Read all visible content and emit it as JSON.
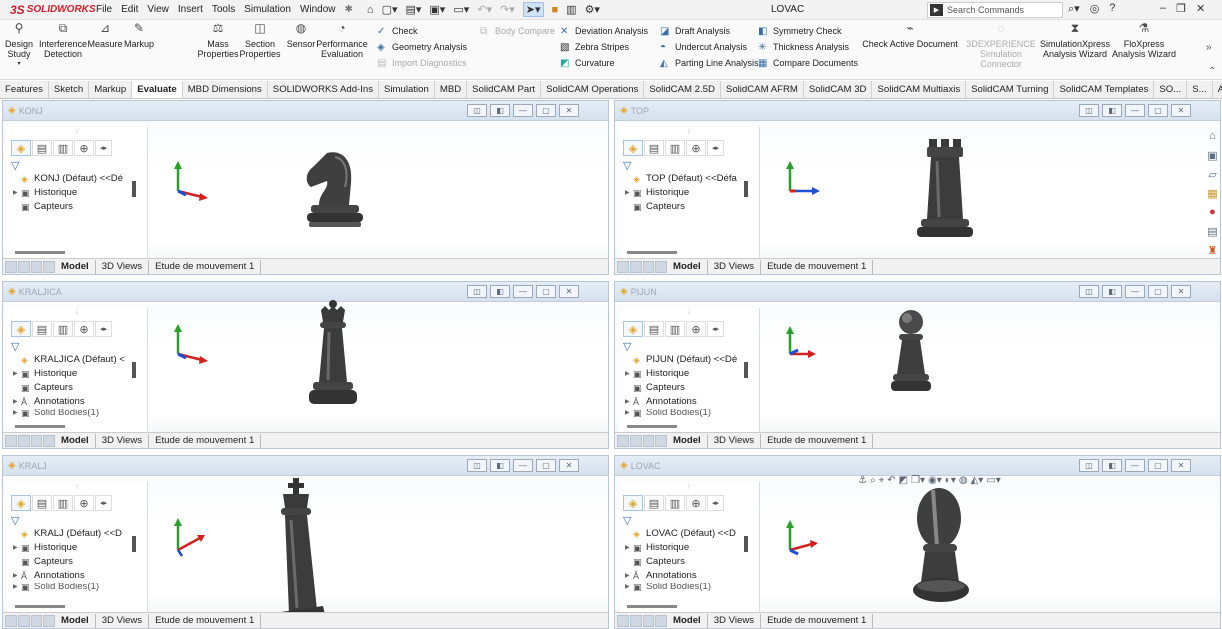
{
  "app": {
    "logo_ds": "3S",
    "logo_text": "SOLIDWORKS",
    "doc_title": "LOVAC"
  },
  "menu": [
    "File",
    "Edit",
    "View",
    "Insert",
    "Tools",
    "Simulation",
    "Window"
  ],
  "search": {
    "placeholder": "Search Commands",
    "icon": "solidworks-search-icon"
  },
  "ribbon": {
    "design_study": "Design Study",
    "interference": "Interference Detection",
    "measure": "Measure",
    "markup": "Markup",
    "mass_properties": "Mass Properties",
    "section_properties": "Section Properties",
    "sensor": "Sensor",
    "performance": "Performance Evaluation",
    "check": "Check",
    "geometry_analysis": "Geometry Analysis",
    "import_diagnostics": "Import Diagnostics",
    "body_compare": "Body Compare",
    "deviation_analysis": "Deviation Analysis",
    "zebra_stripes": "Zebra Stripes",
    "curvature": "Curvature",
    "draft_analysis": "Draft Analysis",
    "undercut_analysis": "Undercut Analysis",
    "parting_line": "Parting Line Analysis",
    "symmetry_check": "Symmetry Check",
    "thickness_analysis": "Thickness Analysis",
    "compare_documents": "Compare Documents",
    "check_active_document": "Check Active Document",
    "experience_sim": "3DEXPERIENCE Simulation Connector",
    "simxpress": "SimulationXpress Analysis Wizard",
    "floxpress": "FloXpress Analysis Wizard"
  },
  "tabs": [
    "Features",
    "Sketch",
    "Markup",
    "Evaluate",
    "MBD Dimensions",
    "SOLIDWORKS Add-Ins",
    "Simulation",
    "MBD",
    "SolidCAM Part",
    "SolidCAM Operations",
    "SolidCAM 2.5D",
    "SolidCAM AFRM",
    "SolidCAM 3D",
    "SolidCAM Multiaxis",
    "SolidCAM Turning",
    "SolidCAM Templates",
    "SO...",
    "S...",
    "A..."
  ],
  "active_tab": "Evaluate",
  "common": {
    "historique": "Historique",
    "capteurs": "Capteurs",
    "annotations": "Annotations",
    "solid_bodies": "Solid Bodies(1)",
    "tab_model": "Model",
    "tab_3dviews": "3D Views",
    "tab_motion": "Etude de mouvement 1"
  },
  "viewports": [
    {
      "title": "KONJ",
      "root": "KONJ (Défaut) <<Dé"
    },
    {
      "title": "TOP",
      "root": "TOP (Défaut) <<Défa"
    },
    {
      "title": "KRALJICA",
      "root": "KRALJICA (Défaut) <"
    },
    {
      "title": "PIJUN",
      "root": "PIJUN (Défaut) <<Dé"
    },
    {
      "title": "KRALJ",
      "root": "KRALJ (Défaut) <<D"
    },
    {
      "title": "LOVAC",
      "root": "LOVAC (Défaut) <<D"
    }
  ],
  "colors": {
    "accent": "#d1202f",
    "axis_x": "#d3211f",
    "axis_y": "#2aa02a",
    "axis_z": "#1f4fd1",
    "piece": "#3f3f3f"
  }
}
